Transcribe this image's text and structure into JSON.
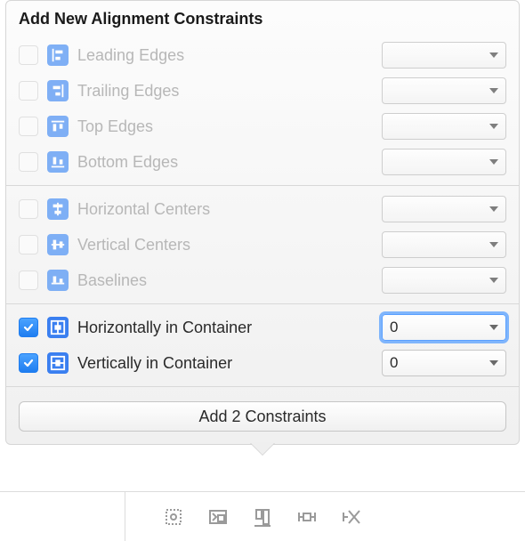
{
  "title": "Add New Alignment Constraints",
  "rows": [
    {
      "id": "leading-edges",
      "label": "Leading Edges",
      "checked": false,
      "enabled": false,
      "value": "",
      "icon": "leading"
    },
    {
      "id": "trailing-edges",
      "label": "Trailing Edges",
      "checked": false,
      "enabled": false,
      "value": "",
      "icon": "trailing"
    },
    {
      "id": "top-edges",
      "label": "Top Edges",
      "checked": false,
      "enabled": false,
      "value": "",
      "icon": "top"
    },
    {
      "id": "bottom-edges",
      "label": "Bottom Edges",
      "checked": false,
      "enabled": false,
      "value": "",
      "icon": "bottom"
    },
    {
      "id": "horizontal-centers",
      "label": "Horizontal Centers",
      "checked": false,
      "enabled": false,
      "value": "",
      "icon": "hcenters"
    },
    {
      "id": "vertical-centers",
      "label": "Vertical Centers",
      "checked": false,
      "enabled": false,
      "value": "",
      "icon": "vcenters"
    },
    {
      "id": "baselines",
      "label": "Baselines",
      "checked": false,
      "enabled": false,
      "value": "",
      "icon": "baselines"
    },
    {
      "id": "horiz-in-container",
      "label": "Horizontally in Container",
      "checked": true,
      "enabled": true,
      "value": "0",
      "icon": "hcontainer",
      "focused": true
    },
    {
      "id": "vert-in-container",
      "label": "Vertically in Container",
      "checked": true,
      "enabled": true,
      "value": "0",
      "icon": "vcontainer"
    }
  ],
  "dividers_after": [
    3,
    6
  ],
  "add_button_label": "Add 2 Constraints",
  "toolbar_icons": [
    "update-frames",
    "embed-in",
    "align",
    "pin",
    "resolve"
  ]
}
